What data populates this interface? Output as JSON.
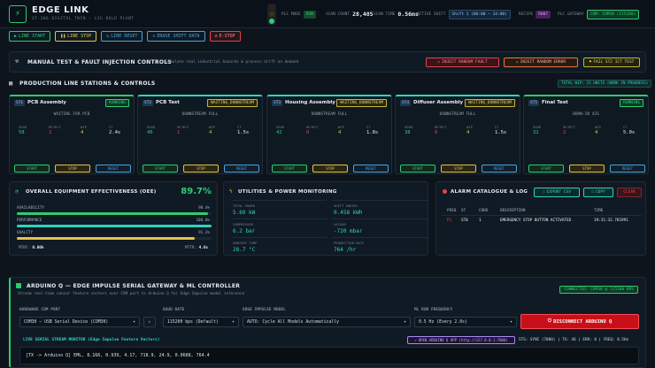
{
  "header": {
    "logo_glyph": "⚡",
    "brand": "EDGE LINK",
    "subtitle": "ST-306 DIGITAL TWIN — LIG BOLD PLANT",
    "plc_mode_label": "PLC MODE",
    "plc_mode_value": "RUN",
    "scan_count_label": "SCAN COUNT",
    "scan_count_value": "28,485",
    "scan_time_label": "SCAN TIME",
    "scan_time_value": "0.56ms",
    "active_shift_label": "ACTIVE SHIFT",
    "active_shift_value": "Shift 1 (06:00 – 14:00)",
    "recipe_label": "RECIPE",
    "recipe_value": "R007",
    "plc_gateway_label": "PLC GATEWAY",
    "plc_gateway_value": "COM: COM30 (115200)"
  },
  "toolbar": {
    "line_start": "LINE START",
    "line_stop": "LINE STOP",
    "line_reset": "LINE RESET",
    "erase_shift": "ERASE SHIFT DATA",
    "estop": "E-STOP"
  },
  "manual": {
    "title": "MANUAL TEST & FAULT INJECTION CONTROLS",
    "desc": "Simulate real industrial hazards & process drift on demand",
    "inject_fault": "INJECT RANDOM FAULT",
    "inject_error": "INJECT RANDOM ERROR",
    "fail_ict": "FAIL ST2 ICT TEST"
  },
  "stations_section": {
    "title": "PRODUCTION LINE STATIONS & CONTROLS",
    "wip_badge": "TOTAL WIP: 23 UNITS (WORK IN PROGRESS)"
  },
  "station_labels": {
    "good": "GOOD",
    "reject": "REJECT",
    "wip": "WIP",
    "ct": "CT",
    "start": "START",
    "stop": "STOP",
    "reset": "RESET"
  },
  "stations": [
    {
      "tag": "ST1",
      "name": "PCB Assembly",
      "status": "RUNNING",
      "msg": "WAITING FOR PCB",
      "good": "58",
      "reject": "2",
      "wip": "4",
      "ct": "2.4s"
    },
    {
      "tag": "ST2",
      "name": "PCB Test",
      "status": "WAITING_DOWNSTREAM",
      "msg": "DOWNSTREAM FULL",
      "good": "46",
      "reject": "1",
      "wip": "4",
      "ct": "1.5s"
    },
    {
      "tag": "ST3",
      "name": "Housing Assembly",
      "status": "WAITING_DOWNSTREAM",
      "msg": "DOWNSTREAM FULL",
      "good": "42",
      "reject": "0",
      "wip": "4",
      "ct": "1.8s"
    },
    {
      "tag": "ST4",
      "name": "Diffuser Assembly",
      "status": "WAITING_DOWNSTREAM",
      "msg": "DOWNSTREAM FULL",
      "good": "38",
      "reject": "0",
      "wip": "4",
      "ct": "1.5s"
    },
    {
      "tag": "ST5",
      "name": "Final Test",
      "status": "RUNNING",
      "msg": "BURN-IN 42S",
      "good": "31",
      "reject": "2",
      "wip": "4",
      "ct": "5.0s"
    }
  ],
  "oee": {
    "title": "OVERALL EQUIPMENT EFFECTIVENESS (OEE)",
    "value": "89.7%",
    "availability_label": "AVAILABILITY",
    "availability_value": "98.4%",
    "availability_frac": 0.984,
    "performance_label": "PERFORMANCE",
    "performance_value": "100.0%",
    "performance_frac": 1.0,
    "quality_label": "QUALITY",
    "quality_value": "91.2%",
    "quality_frac": 0.912,
    "mtbf_label": "MTBF:",
    "mtbf_value": "0.00h",
    "mttr_label": "MTTR:",
    "mttr_value": "4.6s"
  },
  "utilities": {
    "title": "UTILITIES & POWER MONITORING",
    "items": [
      {
        "label": "TOTAL POWER",
        "value": "5.60 kW"
      },
      {
        "label": "SHIFT ENERGY",
        "value": "0.458 kWh"
      },
      {
        "label": "COMPRESSOR",
        "value": "6.2 bar"
      },
      {
        "label": "VACUUM",
        "value": "-720 mbar"
      },
      {
        "label": "AMBIENT TEMP",
        "value": "28.7 °C"
      },
      {
        "label": "PRODUCTION RATE",
        "value": "764 /hr"
      }
    ]
  },
  "alarm": {
    "title": "ALARM CATALOGUE & LOG",
    "export": "EXPORT CSV",
    "copy": "COPY",
    "clear": "CLEAR",
    "cols": [
      "PRIO",
      "ST",
      "CODE",
      "DESCRIPTION",
      "TIME"
    ],
    "rows": [
      {
        "prio": "P1",
        "st": "ST0",
        "code": "1",
        "desc": "EMERGENCY STOP BUTTON ACTIVATED",
        "time": "19:31:32.781991"
      }
    ]
  },
  "arduino": {
    "title": "ARDUINO Q — EDGE IMPULSE SERIAL GATEWAY & ML CONTROLLER",
    "desc": "Stream real-time sensor feature vectors over COM port to Arduino Q for Edge Impulse model inference",
    "connected": "CONNECTED: COM30 @ 115200 BPS",
    "port_label": "HARDWARE COM PORT",
    "port_value": "COM30 — USB Serial Device (COM30)",
    "baud_label": "BAUD RATE",
    "baud_value": "115200 bps (Default)",
    "model_label": "EDGE IMPULSE MODEL",
    "model_value": "AUTO: Cycle All Models Automatically",
    "freq_label": "ML RUN FREQUENCY",
    "freq_value": "0.5 Hz (Every 2.0s)",
    "disconnect": "DISCONNECT ARDUINO Q",
    "monitor_label": "LIVE SERIAL STREAM MONITOR (Edge Impulse Feature Vectors)",
    "open_app": "OPEN ARDUINO Q APP (http://127.0.0.1:7000)",
    "stats": "STS: SYNC (7000) | TX: 46 | ERR: 0 | FREQ: 0.5Hz",
    "stream_line": "[TX -> Arduino Q] EML, 8.166, 0.939, 4.17, 718.9, 24.9, 0.0688, 764.4"
  },
  "colors": {
    "green": "#2ecc71",
    "yellow": "#e5c34a",
    "blue": "#4aa3e0",
    "red": "#e0444c",
    "teal": "#2dd4bf",
    "purple": "#a78bfa"
  }
}
